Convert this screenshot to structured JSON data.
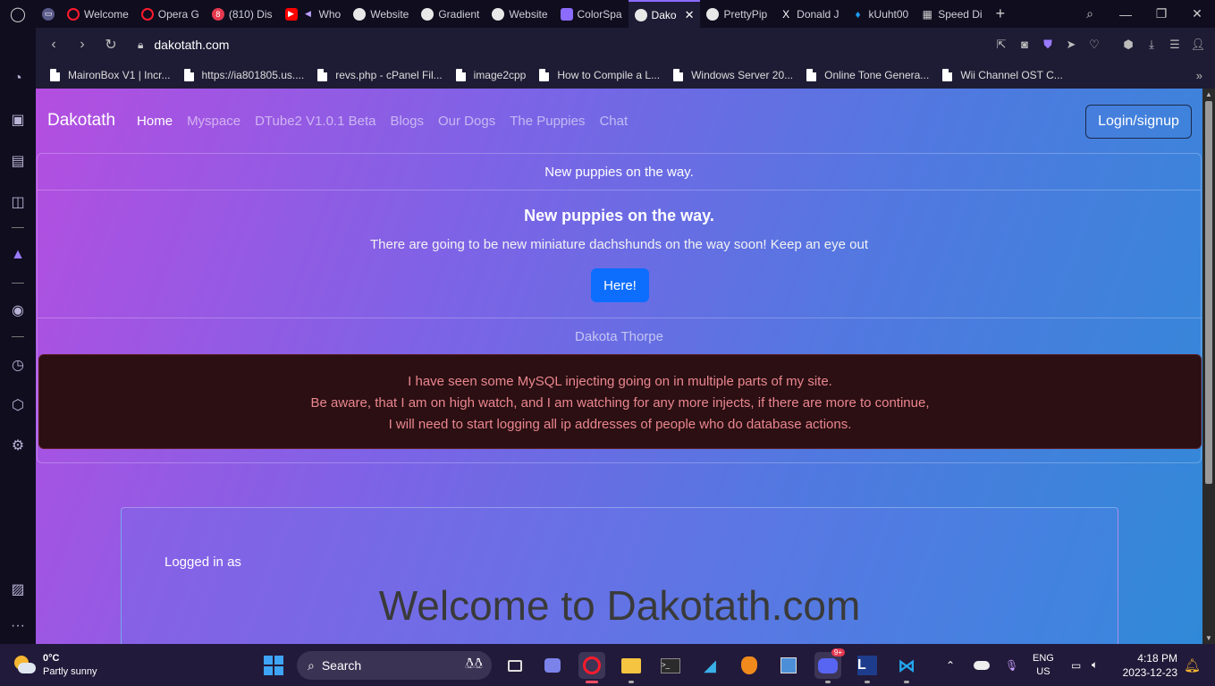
{
  "browser": {
    "tabs": [
      {
        "label": "",
        "icon": "gamepad-icon",
        "color": "#5a5a8a"
      },
      {
        "label": "Welcome",
        "icon": "opera-icon",
        "color": "#ff1b2d"
      },
      {
        "label": "Opera G",
        "icon": "opera-icon",
        "color": "#ff1b2d"
      },
      {
        "label": "(810) Dis",
        "icon": "discord-icon",
        "color": "#5865f2"
      },
      {
        "label": "Who",
        "icon": "youtube-icon",
        "color": "#ff0000"
      },
      {
        "label": "Website",
        "icon": "globe-icon",
        "color": "#e8e8e8"
      },
      {
        "label": "Gradient",
        "icon": "globe-icon",
        "color": "#e8e8e8"
      },
      {
        "label": "Website",
        "icon": "globe-icon",
        "color": "#e8e8e8"
      },
      {
        "label": "ColorSpa",
        "icon": "colorspace-icon",
        "color": "#8b6cff"
      },
      {
        "label": "Dako",
        "icon": "globe-icon",
        "color": "#e8e8e8",
        "active": true
      },
      {
        "label": "PrettyPip",
        "icon": "globe-icon",
        "color": "#e8e8e8"
      },
      {
        "label": "Donald J",
        "icon": "x-logo-icon",
        "color": "#ffffff"
      },
      {
        "label": "kUuht00",
        "icon": "twitter-icon",
        "color": "#1d9bf0"
      },
      {
        "label": "Speed Di",
        "icon": "grid-icon",
        "color": "#cccccc"
      }
    ],
    "url": "dakotath.com",
    "bookmarks": [
      "MaironBox V1 | Incr...",
      "https://ia801805.us....",
      "revs.php - cPanel Fil...",
      "image2cpp",
      "How to Compile a L...",
      "Windows Server 20...",
      "Online Tone Genera...",
      "Wii Channel OST C..."
    ]
  },
  "site": {
    "brand": "Dakotath",
    "nav": [
      "Home",
      "Myspace",
      "DTube2 V1.0.1 Beta",
      "Blogs",
      "Our Dogs",
      "The Puppies",
      "Chat"
    ],
    "login_label": "Login/signup",
    "card": {
      "header": "New puppies on the way.",
      "title": "New puppies on the way.",
      "text": "There are going to be new miniature dachshunds on the way soon! Keep an eye out",
      "button": "Here!",
      "footer": "Dakota Thorpe"
    },
    "alert": {
      "line1": "I have seen some MySQL injecting going on in multiple parts of my site.",
      "line2": "Be aware, that I am on high watch, and I am watching for any more injects, if there are more to continue,",
      "line3": "I will need to start logging all ip addresses of people who do database actions."
    },
    "welcome": {
      "logged_in": "Logged in as",
      "title": "Welcome to Dakotath.com"
    }
  },
  "taskbar": {
    "temperature": "0°C",
    "weather": "Partly sunny",
    "search_placeholder": "Search",
    "lang_top": "ENG",
    "lang_bottom": "US",
    "time": "4:18 PM",
    "date": "2023-12-23",
    "discord_badge": "9+"
  },
  "colors": {
    "primary_button": "#0d6efd",
    "alert_bg": "#2b0f12",
    "alert_text": "#ea868f",
    "opera_accent": "#8a6cff"
  }
}
